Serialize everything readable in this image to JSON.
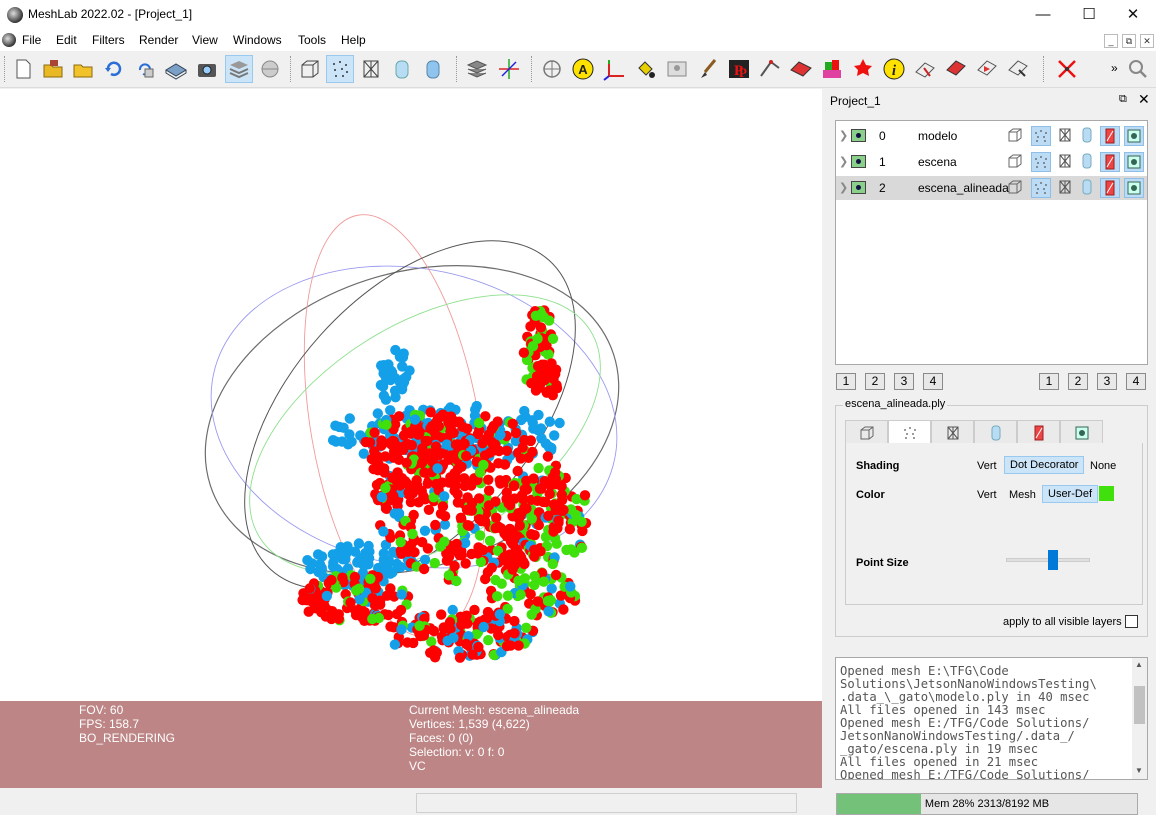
{
  "window": {
    "title": "MeshLab 2022.02 - [Project_1]",
    "controls": {
      "minimize": "—",
      "maximize": "☐",
      "close": "✕"
    }
  },
  "menu": {
    "items": [
      "File",
      "Edit",
      "Filters",
      "Render",
      "View",
      "Windows",
      "Tools",
      "Help"
    ],
    "mdi": {
      "minimize": "_",
      "restore": "⧉",
      "close": "✕"
    }
  },
  "toolbar": {
    "overflow": "»",
    "icons": [
      "new-project",
      "open-project",
      "import-mesh",
      "reload",
      "reload-all",
      "export-mesh",
      "snapshot",
      "layer-stack",
      "raster",
      "bbox",
      "points",
      "wireframe",
      "flat",
      "smooth",
      "align-layers",
      "xyz-axes",
      "measure",
      "annotate-a",
      "axes",
      "paint-can",
      "image-alignment",
      "paint-brush",
      "pickpoints",
      "manual-align",
      "select-faces",
      "select-vertices",
      "colorize",
      "georef",
      "info",
      "select-connected",
      "z-paint",
      "select-area",
      "select-arrow",
      "delete-selected",
      "search"
    ]
  },
  "hud": {
    "fov": "FOV: 60",
    "fps": "FPS:   158.7",
    "rendering": "BO_RENDERING",
    "current_mesh": "Current Mesh: escena_alineada",
    "vertices": "Vertices: 1,539    (4,622)",
    "faces": "Faces: 0    (0)",
    "selection": "Selection: v: 0 f: 0",
    "vc": "VC"
  },
  "colors": {
    "hud_bg": "#bd8585",
    "cloud_red": "#ff0000",
    "cloud_green": "#3fe00c",
    "cloud_blue": "#14a0e8"
  },
  "dock": {
    "title": "Project_1",
    "float_icon": "⧉",
    "close_icon": "✕",
    "layers": [
      {
        "index": "0",
        "name": "modelo",
        "selected": false
      },
      {
        "index": "1",
        "name": "escena",
        "selected": false
      },
      {
        "index": "2",
        "name": "escena_alineada",
        "selected": true
      }
    ],
    "view_buttons_left": [
      "1",
      "2",
      "3",
      "4"
    ],
    "view_buttons_right": [
      "1",
      "2",
      "3",
      "4"
    ],
    "mesh_file": "escena_alineada.ply",
    "tabs": [
      "bbox",
      "points",
      "wireframe",
      "flat",
      "textured",
      "vertex-normals"
    ],
    "shading": {
      "label": "Shading",
      "options": [
        "Vert",
        "Dot Decorator",
        "None"
      ],
      "selected": "Dot Decorator"
    },
    "color": {
      "label": "Color",
      "options": [
        "Vert",
        "Mesh",
        "User-Def"
      ],
      "selected": "User-Def",
      "swatch": "#3fe00c"
    },
    "point_size": {
      "label": "Point Size",
      "value": 0.55
    },
    "apply_all": "apply to all visible layers",
    "log": [
      "Opened mesh E:\\TFG\\Code",
      "Solutions\\JetsonNanoWindowsTesting\\",
      ".data_\\_gato\\modelo.ply in 40 msec",
      "All files opened in 143 msec",
      "Opened mesh E:/TFG/Code Solutions/",
      "JetsonNanoWindowsTesting/.data_/",
      "_gato/escena.ply in 19 msec",
      "All files opened in 21 msec",
      "Opened mesh E:/TFG/Code Solutions/"
    ]
  },
  "status": {
    "memory": "Mem 28% 2313/8192 MB",
    "memory_fraction": 0.28
  }
}
